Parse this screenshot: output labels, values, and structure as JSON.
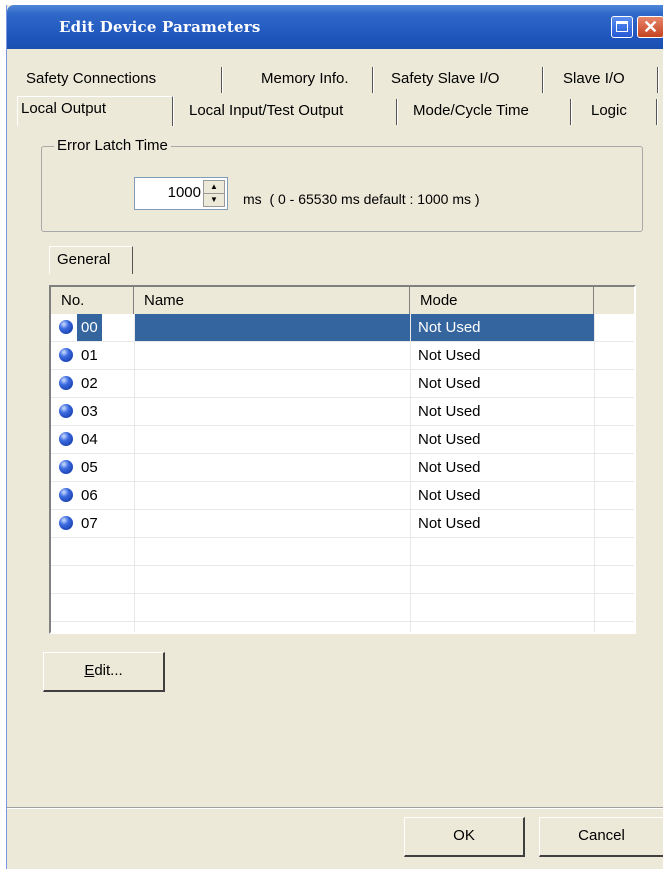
{
  "window": {
    "title": "Edit Device Parameters"
  },
  "tabs_row1": [
    "Safety Connections",
    "Memory Info.",
    "Safety Slave I/O",
    "Slave I/O"
  ],
  "tabs_row2": [
    "Local Output",
    "Local Input/Test Output",
    "Mode/Cycle Time",
    "Logic"
  ],
  "active_tab": "Local Output",
  "error_latch": {
    "group_label": "Error Latch Time",
    "value": "1000",
    "unit": "ms",
    "range_hint": "( 0 - 65530 ms   default : 1000 ms )"
  },
  "subtabs": [
    "General"
  ],
  "table": {
    "columns": [
      "No.",
      "Name",
      "Mode"
    ],
    "rows": [
      {
        "no": "00",
        "name": "",
        "mode": "Not Used",
        "selected": true
      },
      {
        "no": "01",
        "name": "",
        "mode": "Not Used"
      },
      {
        "no": "02",
        "name": "",
        "mode": "Not Used"
      },
      {
        "no": "03",
        "name": "",
        "mode": "Not Used"
      },
      {
        "no": "04",
        "name": "",
        "mode": "Not Used"
      },
      {
        "no": "05",
        "name": "",
        "mode": "Not Used"
      },
      {
        "no": "06",
        "name": "",
        "mode": "Not Used"
      },
      {
        "no": "07",
        "name": "",
        "mode": "Not Used"
      }
    ]
  },
  "buttons": {
    "edit_u": "E",
    "edit_rest": "dit...",
    "ok": "OK",
    "cancel": "Cancel"
  },
  "colors": {
    "titlebar": "#1f57be",
    "selection": "#34659e",
    "dialog_bg": "#ece9d8"
  }
}
